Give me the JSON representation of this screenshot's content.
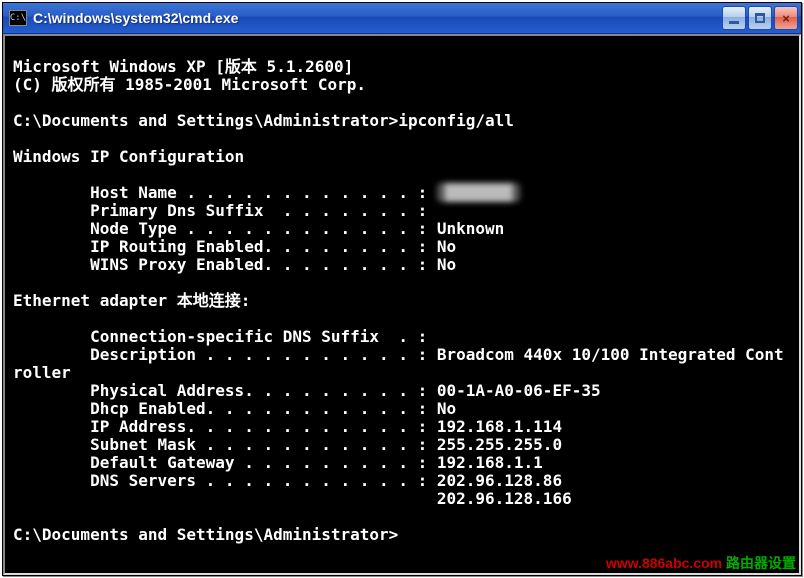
{
  "window": {
    "icon_glyph": "C:\\",
    "title": "C:\\windows\\system32\\cmd.exe"
  },
  "terminal": {
    "header1": "Microsoft Windows XP [版本 5.1.2600]",
    "header2": "(C) 版权所有 1985-2001 Microsoft Corp.",
    "prompt1_path": "C:\\Documents and Settings\\Administrator>",
    "command": "ipconfig/all",
    "section_winip": "Windows IP Configuration",
    "host_name_label": "        Host Name . . . . . . . . . . . . : ",
    "host_name_value": "███████",
    "primary_dns_suffix": "        Primary Dns Suffix  . . . . . . . :",
    "node_type": "        Node Type . . . . . . . . . . . . : Unknown",
    "ip_routing": "        IP Routing Enabled. . . . . . . . : No",
    "wins_proxy": "        WINS Proxy Enabled. . . . . . . . : No",
    "section_eth": "Ethernet adapter 本地连接:",
    "conn_dns": "        Connection-specific DNS Suffix  . :",
    "desc_line1": "        Description . . . . . . . . . . . : Broadcom 440x 10/100 Integrated Cont",
    "desc_line2": "roller",
    "phys_addr": "        Physical Address. . . . . . . . . : 00-1A-A0-06-EF-35",
    "dhcp": "        Dhcp Enabled. . . . . . . . . . . : No",
    "ip_addr": "        IP Address. . . . . . . . . . . . : 192.168.1.114",
    "subnet": "        Subnet Mask . . . . . . . . . . . : 255.255.255.0",
    "gateway": "        Default Gateway . . . . . . . . . : 192.168.1.1",
    "dns1": "        DNS Servers . . . . . . . . . . . : 202.96.128.86",
    "dns2": "                                            202.96.128.166",
    "prompt2": "C:\\Documents and Settings\\Administrator>"
  },
  "watermark": {
    "url": "www.886abc.com",
    "txt": " 路由器设置"
  }
}
